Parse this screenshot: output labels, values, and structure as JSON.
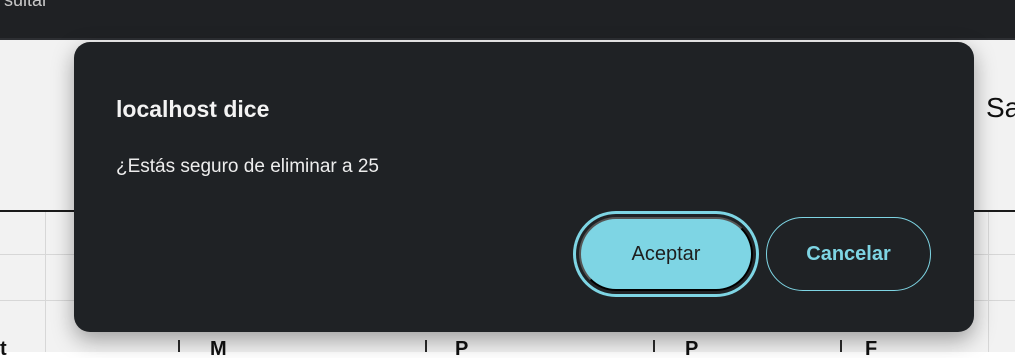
{
  "background": {
    "top_bar_text": "sultar",
    "header_fragment": "Sa",
    "bottom_labels": [
      "t",
      "M",
      "P",
      "P",
      "F"
    ]
  },
  "dialog": {
    "title": "localhost dice",
    "message": "¿Estás seguro de eliminar a 25",
    "accept_label": "Aceptar",
    "cancel_label": "Cancelar"
  },
  "colors": {
    "dialog_background": "#1f2225",
    "accent": "#7ed5e4",
    "text_primary": "#f3f3f3"
  }
}
